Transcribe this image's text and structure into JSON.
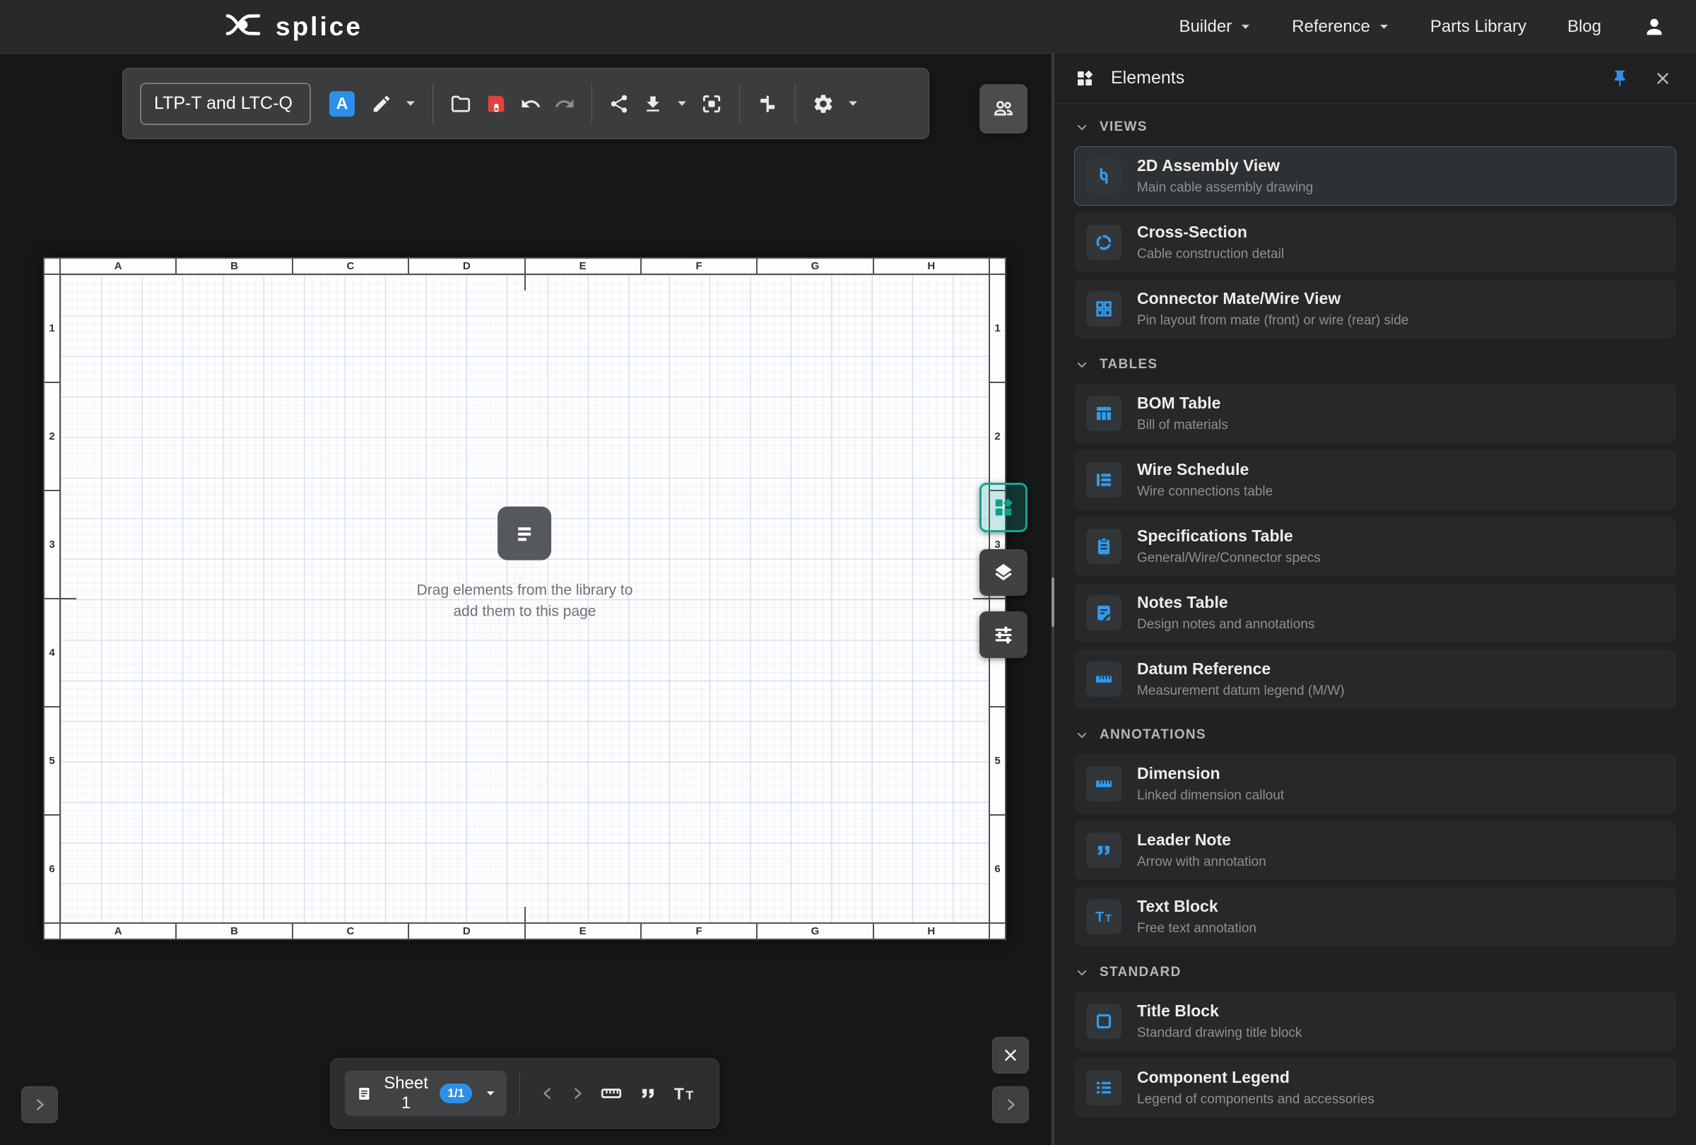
{
  "navbar": {
    "brand": "splice",
    "menu": [
      {
        "label": "Builder"
      },
      {
        "label": "Reference"
      },
      {
        "label": "Parts Library"
      },
      {
        "label": "Blog"
      }
    ]
  },
  "toolbar": {
    "drawing_title": "LTP-T and LTC-Q",
    "revision_badge": "A"
  },
  "sheet": {
    "columns": [
      "A",
      "B",
      "C",
      "D",
      "E",
      "F",
      "G",
      "H"
    ],
    "rows": [
      "1",
      "2",
      "3",
      "4",
      "5",
      "6"
    ],
    "empty_line1": "Drag elements from the library to",
    "empty_line2": "add them to this page"
  },
  "panel": {
    "title": "Elements",
    "sections": [
      {
        "label": "VIEWS",
        "items": [
          {
            "name": "2D Assembly View",
            "desc": "Main cable assembly drawing",
            "icon": "cable-icon"
          },
          {
            "name": "Cross-Section",
            "desc": "Cable construction detail",
            "icon": "cross-section-icon"
          },
          {
            "name": "Connector Mate/Wire View",
            "desc": "Pin layout from mate (front) or wire (rear) side",
            "icon": "pin-grid-icon"
          }
        ]
      },
      {
        "label": "TABLES",
        "items": [
          {
            "name": "BOM Table",
            "desc": "Bill of materials",
            "icon": "table-columns-icon"
          },
          {
            "name": "Wire Schedule",
            "desc": "Wire connections table",
            "icon": "table-rows-icon"
          },
          {
            "name": "Specifications Table",
            "desc": "General/Wire/Connector specs",
            "icon": "clipboard-icon"
          },
          {
            "name": "Notes Table",
            "desc": "Design notes and annotations",
            "icon": "note-edit-icon"
          },
          {
            "name": "Datum Reference",
            "desc": "Measurement datum legend (M/W)",
            "icon": "ruler-icon"
          }
        ]
      },
      {
        "label": "ANNOTATIONS",
        "items": [
          {
            "name": "Dimension",
            "desc": "Linked dimension callout",
            "icon": "ruler-icon"
          },
          {
            "name": "Leader Note",
            "desc": "Arrow with annotation",
            "icon": "quote-icon"
          },
          {
            "name": "Text Block",
            "desc": "Free text annotation",
            "icon": "text-icon"
          }
        ]
      },
      {
        "label": "STANDARD",
        "items": [
          {
            "name": "Title Block",
            "desc": "Standard drawing title block",
            "icon": "square-outline-icon"
          },
          {
            "name": "Component Legend",
            "desc": "Legend of components and accessories",
            "icon": "bullet-list-icon"
          }
        ]
      }
    ]
  },
  "bottombar": {
    "sheet_name": "Sheet 1",
    "sheet_count": "1/1"
  },
  "colors": {
    "accent_blue": "#2e9cf0",
    "teal": "#14a08e",
    "save_red": "#e0433d"
  }
}
